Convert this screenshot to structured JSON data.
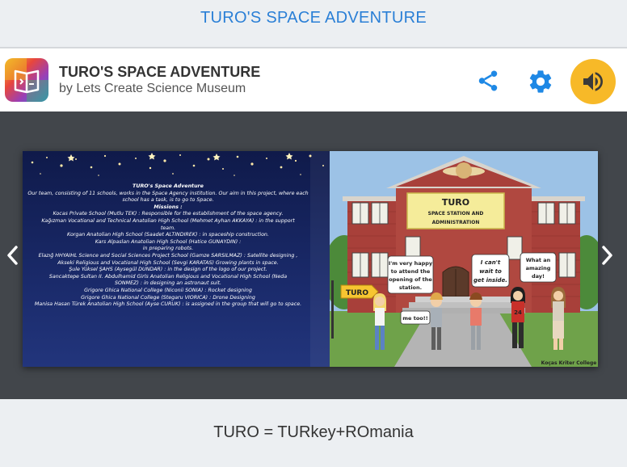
{
  "page": {
    "title": "TURO'S SPACE ADVENTURE"
  },
  "header": {
    "book_title": "TURO'S SPACE ADVENTURE",
    "author": "by Lets Create Science Museum",
    "icons": {
      "logo": "book-creator-logo",
      "share": "share-icon",
      "settings": "gear-icon",
      "audio": "speaker-icon"
    },
    "colors": {
      "accent": "#1e88e5",
      "audio_button": "#f7b928"
    }
  },
  "viewer": {
    "prev_icon": "chevron-left-icon",
    "next_icon": "chevron-right-icon",
    "left_page": {
      "lines": [
        "TURO's Space Adventure",
        "Our team, consisting of 11 schools, works in the Space Agency institution. Our aim in this project, where each",
        "school has a task, is to go to Space.",
        "Missions :",
        "Kocas Private School (Mutlu TEK) : Responsible for the establishment of the space agency.",
        "Kağızman Vocational and Technical Anatolian High School (Mehmet Ayhan AKKAYA) : in the support",
        "team.",
        "Korgan Anatolian High School (Saadet ALTINDIREK) : in spaceship construction.",
        "Kars Alpaslan Anatolian High School (Hatice GUNAYDIN) :",
        "in preparing robots.",
        "Elazığ HHYAİHL Science and Social Sciences Project School (Gamze SARSILMAZ) : Satellite designing ,",
        "Akseki Religious and Vocational High School (Sevgi KARATAS) Growing plants in space.",
        "Şule Yüksel ŞAHS (Aysegül DUNDAR) : in the design of the logo of our project.",
        "Sancaktepe Sultan II. Abdulhamid Girls Anatolian Religious and Vocational High School (Neda",
        "SONMEZ) : in designing an astronaut suit.",
        "Grigore Ghica National College (Niconii SONIA) : Rocket designing",
        "Grigore Ghica National College (Stegaru VIORICA) : Drone Designing",
        "Manisa Hasan Türek Anatolian High School (Ayse CURUK) : is assigned in the group that will go to space."
      ]
    },
    "right_page": {
      "sign_title": "TURO",
      "sign_subtitle": "SPACE STATION AND",
      "sign_subtitle2": "ADMINISTRATION",
      "arrow_sign": "TURO",
      "bubble1": [
        "I'm very happy",
        "to attend the",
        "opening of the",
        "station."
      ],
      "bubble2": [
        "I can't",
        "wait  to",
        "get inside."
      ],
      "bubble3": [
        "What an",
        "amazing",
        "day!"
      ],
      "bubble4": [
        "me too!!"
      ],
      "shirt_number": "24",
      "credit": "Koças Kriter College"
    }
  },
  "caption": "TURO = TURkey+ROmania"
}
